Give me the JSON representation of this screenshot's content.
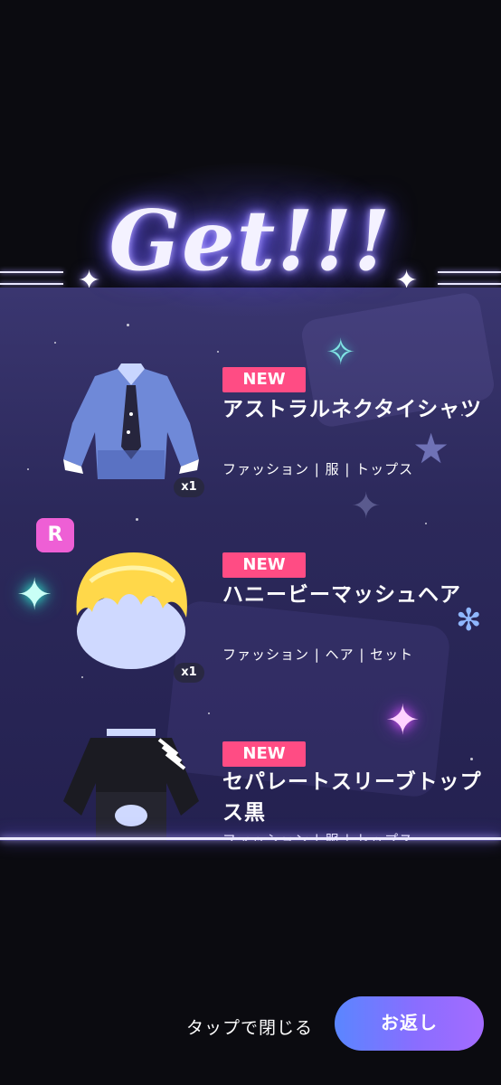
{
  "header": {
    "title": "Get!!!"
  },
  "items": [
    {
      "badge": "NEW",
      "name": "アストラルネクタイシャツ",
      "category": "ファッション | 服 | トップス",
      "quantity": "x1",
      "rarity": "",
      "icon": "tie-shirt-icon"
    },
    {
      "badge": "NEW",
      "name": "ハニービーマッシュヘア",
      "category": "ファッション | ヘア | セット",
      "quantity": "x1",
      "rarity": "R",
      "icon": "mushroom-hair-icon"
    },
    {
      "badge": "NEW",
      "name": "セパレートスリーブトップス黒",
      "category": "ファッション | 服 | トップス",
      "quantity": "",
      "rarity": "",
      "icon": "separate-sleeve-top-icon"
    }
  ],
  "footer": {
    "close_hint": "タップで閉じる",
    "reply_button": "お返し"
  },
  "colors": {
    "new_badge": "#ff4c84",
    "rarity_badge": "#ee5fd5",
    "button_start": "#5a86ff",
    "button_end": "#a46cff",
    "panel": "#2c295b"
  }
}
